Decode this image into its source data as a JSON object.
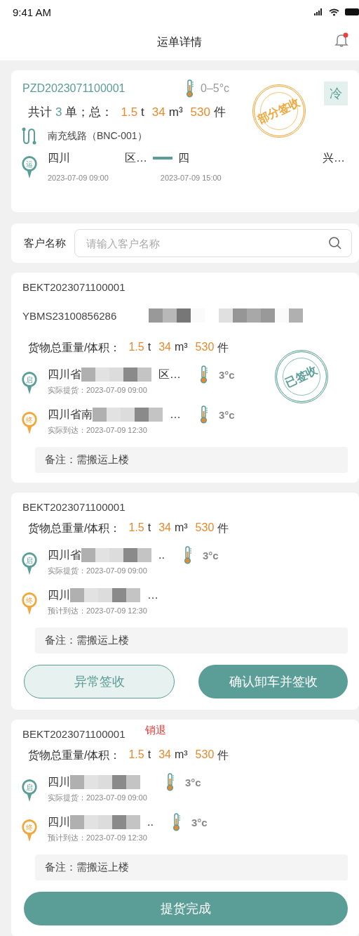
{
  "status_bar": {
    "time": "9:41 AM"
  },
  "header": {
    "title": "运单详情",
    "unread": true
  },
  "summary": {
    "order_no": "PZD2023071100001",
    "temperature": "0–5°c",
    "cold_tag": "冷",
    "totals": [
      {
        "text": "共计",
        "kind": "label"
      },
      {
        "text": "3",
        "kind": "count"
      },
      {
        "text": "单；总：",
        "kind": "label"
      },
      {
        "text": "1.5",
        "kind": "value"
      },
      {
        "text": "t",
        "kind": "unit"
      },
      {
        "text": "34",
        "kind": "value"
      },
      {
        "text": "m³",
        "kind": "unit"
      },
      {
        "text": "530",
        "kind": "value"
      },
      {
        "text": "件",
        "kind": "unit"
      }
    ],
    "stamp": {
      "text": "部分签收",
      "kind": "partial"
    },
    "route": "南充线路（BNC-001）",
    "badge": "运",
    "from": {
      "parts": [
        {
          "kind": "text",
          "text": "四川"
        },
        {
          "kind": "text",
          "text": "区…"
        }
      ],
      "time": "2023-07-09  09:00"
    },
    "to": {
      "parts": [
        {
          "kind": "text",
          "text": "四"
        },
        {
          "kind": "text",
          "text": "兴…"
        }
      ],
      "time": "2023-07-09  15:00"
    }
  },
  "search": {
    "label": "客户名称",
    "placeholder": "请输入客户名称"
  },
  "orders": [
    {
      "number": "BEKT2023071100001",
      "extra_number": {
        "text": "YBMS23100856286",
        "redacted": true
      },
      "measures": [
        {
          "text": "货物总重量/体积：",
          "kind": "label"
        },
        {
          "text": "1.5",
          "kind": "value"
        },
        {
          "text": "t",
          "kind": "unit"
        },
        {
          "text": "34",
          "kind": "value"
        },
        {
          "text": "m³",
          "kind": "unit"
        },
        {
          "text": "530",
          "kind": "value"
        },
        {
          "text": "件",
          "kind": "unit"
        }
      ],
      "stamp": {
        "text": "已签收",
        "kind": "signed"
      },
      "stops": [
        {
          "kind": "start",
          "badge": "启",
          "parts": [
            {
              "kind": "text",
              "text": "四川省"
            },
            {
              "kind": "redacted"
            },
            {
              "kind": "text",
              "text": "区…"
            }
          ],
          "temperature": "3°c",
          "time_label": "实际提货：",
          "time": "2023-07-09  09:00"
        },
        {
          "kind": "end",
          "badge": "终",
          "parts": [
            {
              "kind": "text",
              "text": "四川省南"
            },
            {
              "kind": "redacted"
            },
            {
              "kind": "text",
              "text": "…"
            }
          ],
          "temperature": "3°c",
          "time_label": "实际到达：",
          "time": "2023-07-09  12:30"
        }
      ],
      "note": "备注：需搬运上楼"
    },
    {
      "number": "BEKT2023071100001",
      "measures": [
        {
          "text": "货物总重量/体积：",
          "kind": "label"
        },
        {
          "text": "1.5",
          "kind": "value"
        },
        {
          "text": "t",
          "kind": "unit"
        },
        {
          "text": "34",
          "kind": "value"
        },
        {
          "text": "m³",
          "kind": "unit"
        },
        {
          "text": "530",
          "kind": "value"
        },
        {
          "text": "件",
          "kind": "unit"
        }
      ],
      "stops": [
        {
          "kind": "start",
          "badge": "启",
          "parts": [
            {
              "kind": "text",
              "text": "四川省"
            },
            {
              "kind": "redacted"
            },
            {
              "kind": "text",
              "text": ".."
            }
          ],
          "temperature": "3°c",
          "time_label": "实际提货：",
          "time": "2023-07-09  09:00"
        },
        {
          "kind": "end",
          "badge": "终",
          "parts": [
            {
              "kind": "text",
              "text": "四川"
            },
            {
              "kind": "redacted"
            },
            {
              "kind": "text",
              "text": "…"
            }
          ],
          "time_label": "预计到达：",
          "time": "2023-07-09  12:30"
        }
      ],
      "note": "备注：需搬运上楼",
      "buttons": [
        {
          "label": "异常签收",
          "kind": "outline"
        },
        {
          "label": "确认卸车并签收",
          "kind": "primary"
        }
      ]
    },
    {
      "number": "BEKT2023071100001",
      "status_tag": "销退",
      "measures": [
        {
          "text": "货物总重量/体积：",
          "kind": "label"
        },
        {
          "text": "1.5",
          "kind": "value"
        },
        {
          "text": "t",
          "kind": "unit"
        },
        {
          "text": "34",
          "kind": "value"
        },
        {
          "text": "m³",
          "kind": "unit"
        },
        {
          "text": "530",
          "kind": "value"
        },
        {
          "text": "件",
          "kind": "unit"
        }
      ],
      "stops": [
        {
          "kind": "start",
          "badge": "启",
          "parts": [
            {
              "kind": "text",
              "text": "四川"
            },
            {
              "kind": "redacted"
            }
          ],
          "temperature": "3°c",
          "time_label": "实际提货：",
          "time": "2023-07-09  09:00"
        },
        {
          "kind": "end",
          "badge": "终",
          "parts": [
            {
              "kind": "text",
              "text": "四川"
            },
            {
              "kind": "redacted"
            },
            {
              "kind": "text",
              "text": ".."
            }
          ],
          "temperature": "3°c",
          "time_label": "预计到达：",
          "time": "2023-07-09  12:30"
        }
      ],
      "note": "备注：需搬运上楼",
      "buttons": [
        {
          "label": "提货完成",
          "kind": "primary"
        }
      ]
    }
  ]
}
